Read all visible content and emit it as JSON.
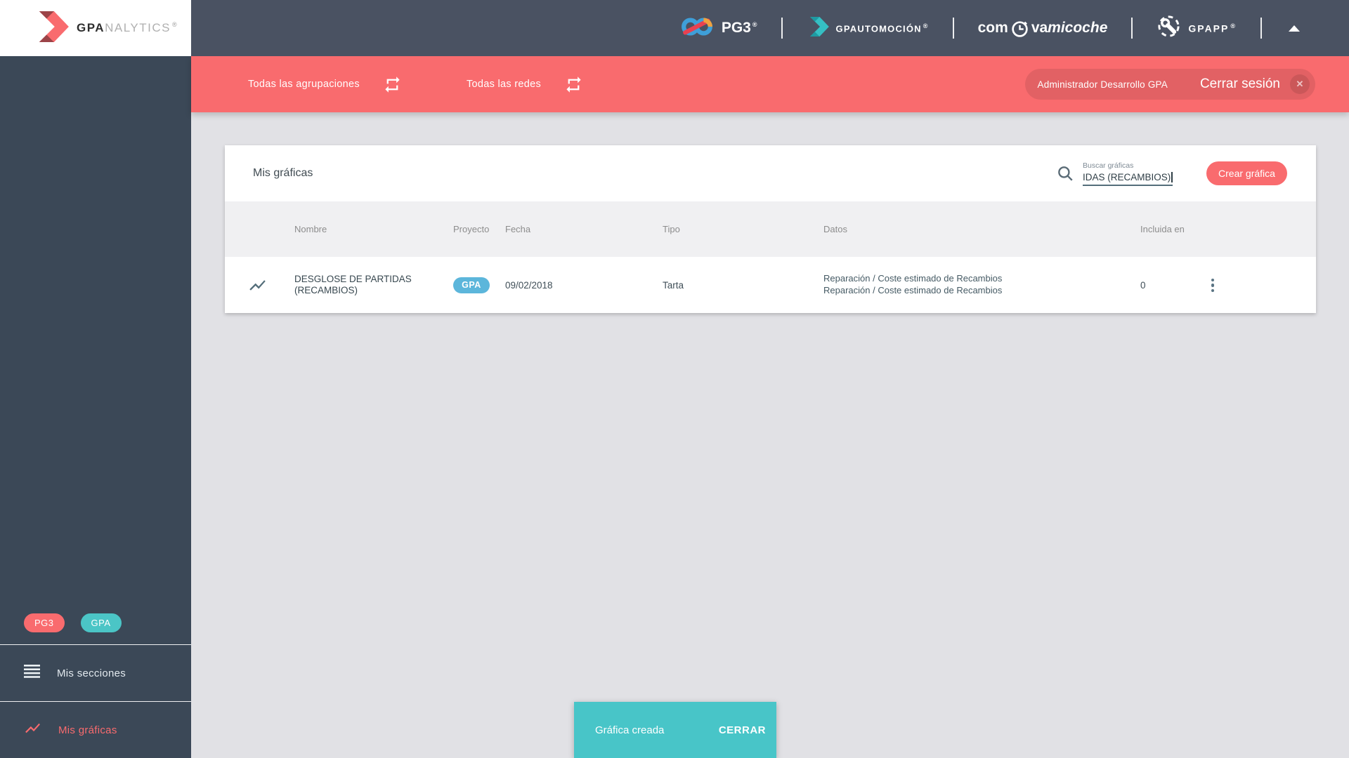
{
  "brand": {
    "wordmark_bold": "GPA",
    "wordmark_light": "NALYTICS",
    "reg_mark": "®"
  },
  "header": {
    "pg3_label": "PG3",
    "automocion_label": "GPAUTOMOCIÓN",
    "coche_part1": "com",
    "coche_part2": "va",
    "coche_part3": "micoche",
    "gpapp_label": "GPAPP"
  },
  "filter_bar": {
    "agrupaciones_label": "Todas las agrupaciones",
    "redes_label": "Todas las redes",
    "user_name": "Administrador Desarrollo GPA",
    "logout_label": "Cerrar sesión",
    "close_x": "✕"
  },
  "sidebar": {
    "badges": [
      {
        "label": "PG3",
        "color": "#F96B6E"
      },
      {
        "label": "GPA",
        "color": "#4BC5C6"
      }
    ],
    "items": [
      {
        "label": "Mis secciones",
        "active": false
      },
      {
        "label": "Mis gráficas",
        "active": true
      }
    ]
  },
  "card": {
    "title": "Mis gráficas",
    "search": {
      "label": "Buscar gráficas",
      "value": "IDAS (RECAMBIOS)"
    },
    "create_button": "Crear gráfica",
    "table": {
      "columns": [
        "Nombre",
        "Proyecto",
        "Fecha",
        "Tipo",
        "Datos",
        "Incluida en"
      ],
      "rows": [
        {
          "name_line1": "DESGLOSE DE PARTIDAS",
          "name_line2": "(RECAMBIOS)",
          "project": "GPA",
          "date": "09/02/2018",
          "type": "Tarta",
          "data_line1": "Reparación / Coste estimado de Recambios",
          "data_line2": "Reparación / Coste estimado de Recambios",
          "included_in": "0"
        }
      ]
    }
  },
  "toast": {
    "message": "Gráfica creada",
    "action": "CERRAR"
  },
  "icons": [
    "gpa-arrow-logo-icon",
    "pg3-infinity-icon",
    "automocion-arrow-icon",
    "clock-icon",
    "wrench-circle-icon",
    "collapse-up-icon",
    "repeat-icon",
    "close-circle-icon",
    "menu-icon",
    "line-chart-icon",
    "search-icon",
    "kebab-menu-icon"
  ],
  "colors": {
    "coral": "#F96B6E",
    "teal": "#48C5C8",
    "badge_blue": "#5CB6DB",
    "topbar": "#4A5262",
    "sidebar": "#3B4857",
    "page_bg": "#E1E1E5",
    "table_head_bg": "#F0F0F2"
  }
}
